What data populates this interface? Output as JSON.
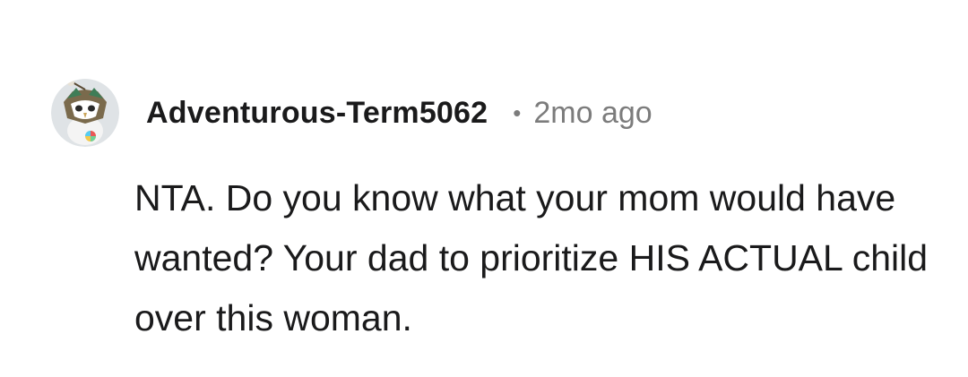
{
  "comment": {
    "author": "Adventurous-Term5062",
    "separator": "•",
    "timestamp": "2mo ago",
    "avatar_icon": "owl-snoo-avatar-icon",
    "text": "NTA. Do you know what your mom would have wanted? Your dad to prioritize HIS ACTUAL child over this woman."
  },
  "colors": {
    "text": "#1a1a1b",
    "meta": "#7c7c7c",
    "background": "#ffffff"
  }
}
